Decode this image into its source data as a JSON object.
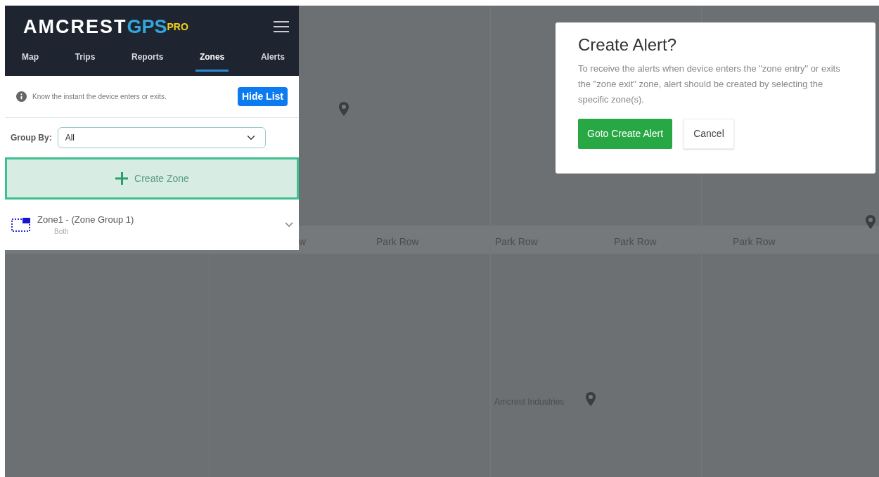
{
  "logo": {
    "text": "AMCREST",
    "accent": "GPS",
    "badge": "PRO"
  },
  "tabs": [
    {
      "label": "Map",
      "selected": false
    },
    {
      "label": "Trips",
      "selected": false
    },
    {
      "label": "Reports",
      "selected": false
    },
    {
      "label": "Zones",
      "selected": true
    },
    {
      "label": "Alerts",
      "selected": false
    }
  ],
  "info": {
    "text": "Know the instant the device enters or exits.",
    "button": "Hide List"
  },
  "group_by": {
    "label": "Group By:",
    "value": "All"
  },
  "create_button": "Create Zone",
  "zones": [
    {
      "title": "Zone1 - (Zone Group 1)",
      "subtitle": "Both",
      "expanded": false
    }
  ],
  "map": {
    "labels": [
      {
        "text": "w",
        "kind": "road"
      },
      {
        "text": "Park Row",
        "kind": "road"
      },
      {
        "text": "Park Row",
        "kind": "road"
      },
      {
        "text": "Park Row",
        "kind": "road"
      },
      {
        "text": "Park Row",
        "kind": "road"
      },
      {
        "text": "Amcrest Industries",
        "kind": "place"
      }
    ]
  },
  "dialog": {
    "title": "Create Alert?",
    "body": "To receive the alerts when device enters the \"zone entry\" or exits the \"zone exit\" zone, alert should be created by selecting the specific zone(s).",
    "buttons": [
      {
        "label": "Goto Create Alert",
        "kind": "primary"
      },
      {
        "label": "Cancel",
        "kind": "secondary"
      }
    ]
  }
}
